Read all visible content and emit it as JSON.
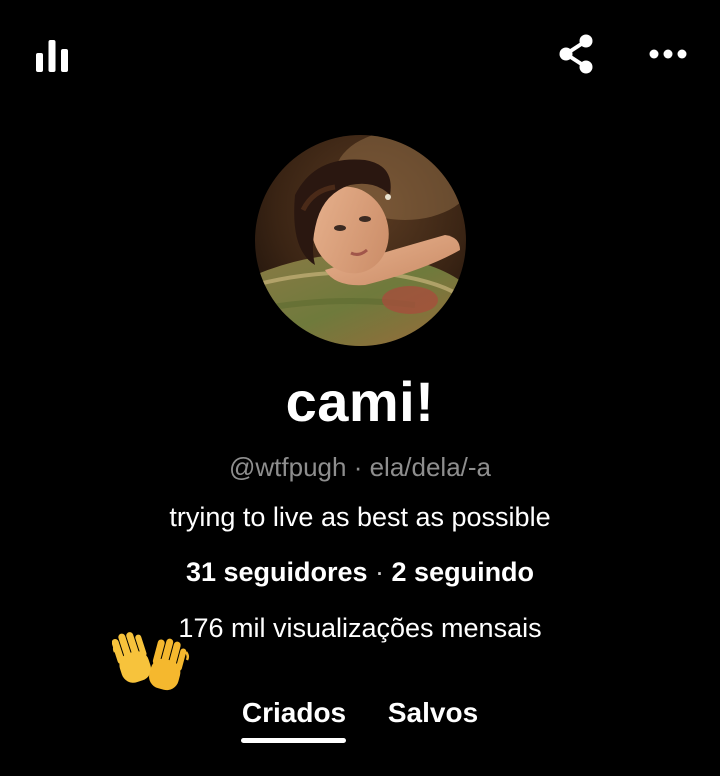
{
  "topbar": {
    "left_icon": "stats-icon",
    "share_icon": "share-icon",
    "more_icon": "more-options-icon"
  },
  "profile": {
    "avatar_icon": "profile-photo",
    "name": "cami!",
    "handle": "@wtfpugh",
    "separator": " · ",
    "pronouns": "ela/dela/-a",
    "bio": "trying to live as best as possible",
    "followers": "31 seguidores",
    "following": "2 seguindo",
    "monthly_views": "176 mil visualizações mensais",
    "emoji": "waving-hands-emoji"
  },
  "tabs": {
    "created": "Criados",
    "saved": "Salvos",
    "active": "created"
  },
  "colors": {
    "background": "#000000",
    "text": "#ffffff",
    "muted": "#8e8e8e",
    "emoji_yellow": "#f7c33c"
  }
}
